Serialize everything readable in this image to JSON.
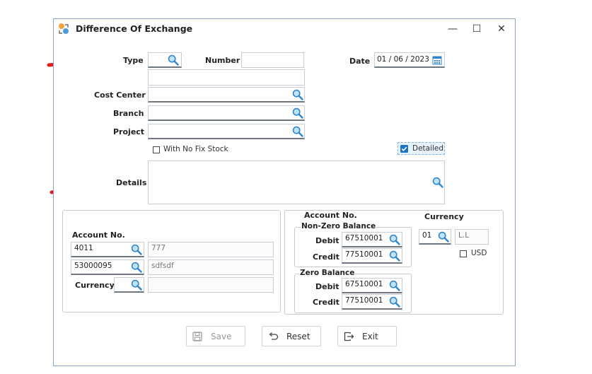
{
  "window": {
    "title": "Difference Of Exchange",
    "controls": {
      "minimize": "—",
      "maximize": "☐",
      "close": "✕"
    }
  },
  "header": {
    "type_label": "Type",
    "type_value": "",
    "number_label": "Number",
    "number_value": "",
    "description_value": "",
    "date_label": "Date",
    "date_value": "01 / 06 / 2023"
  },
  "filters": {
    "cost_center_label": "Cost Center",
    "branch_label": "Branch",
    "project_label": "Project",
    "no_fix_stock_label": "With No Fix Stock",
    "no_fix_stock_checked": false,
    "detailed_label": "Detailed",
    "detailed_checked": true,
    "details_label": "Details",
    "details_value": ""
  },
  "left_panel": {
    "account_no_label": "Account No.",
    "rows": [
      {
        "code": "4011",
        "name": "777"
      },
      {
        "code": "53000095",
        "name": "sdfsdf"
      }
    ],
    "currency_label": "Currency",
    "currency_code": "",
    "currency_name": ""
  },
  "right_panel": {
    "account_no_label": "Account No.",
    "currency_label": "Currency",
    "non_zero": {
      "title": "Non-Zero Balance",
      "debit_label": "Debit",
      "debit_value": "67510001",
      "credit_label": "Credit",
      "credit_value": "77510001"
    },
    "zero": {
      "title": "Zero Balance",
      "debit_label": "Debit",
      "debit_value": "67510001",
      "credit_label": "Credit",
      "credit_value": "77510001"
    },
    "currency_code": "01",
    "currency_name": "L.L",
    "usd_label": "USD",
    "usd_checked": false
  },
  "buttons": {
    "save": "Save",
    "reset": "Reset",
    "exit": "Exit"
  },
  "colors": {
    "annotation_arrow": "#e31b1b",
    "accent": "#1e73be",
    "search_icon": "#3a8fd6"
  }
}
